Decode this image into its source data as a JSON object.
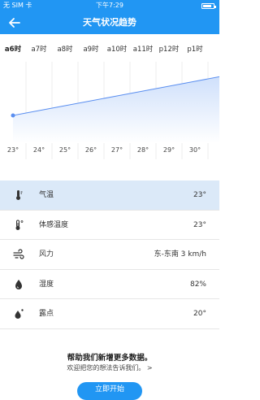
{
  "status_bar": {
    "carrier": "无 SIM 卡",
    "time": "下午7:29"
  },
  "header": {
    "title": "天气状况趋势"
  },
  "hours": [
    "a6时",
    "a7时",
    "a8时",
    "a9时",
    "a10时",
    "a11时",
    "p12时",
    "p1时"
  ],
  "chart_data": {
    "type": "line",
    "x": [
      "a6时",
      "a7时",
      "a8时",
      "a9时",
      "a10时",
      "a11时",
      "p12时",
      "p1时"
    ],
    "values": [
      23,
      24,
      25,
      26,
      27,
      28,
      29,
      30
    ],
    "labels": [
      "23°",
      "24°",
      "25°",
      "26°",
      "27°",
      "28°",
      "29°",
      "30°"
    ],
    "line_color": "#5b8ff0"
  },
  "details": [
    {
      "icon": "thermometer-icon",
      "label": "气温",
      "value": "23°",
      "selected": true
    },
    {
      "icon": "feels-like-icon",
      "label": "体感温度",
      "value": "23°"
    },
    {
      "icon": "wind-icon",
      "label": "风力",
      "value": "东-东南 3 km/h"
    },
    {
      "icon": "humidity-icon",
      "label": "湿度",
      "value": "82%"
    },
    {
      "icon": "dew-point-icon",
      "label": "露点",
      "value": "20°"
    }
  ],
  "help": {
    "title": "帮助我们新增更多数据。",
    "subtitle": "欢迎把您的想法告诉我们。 >",
    "button": "立即开始"
  },
  "colors": {
    "accent": "#2196f3",
    "selected_row": "#dbe9f8"
  }
}
